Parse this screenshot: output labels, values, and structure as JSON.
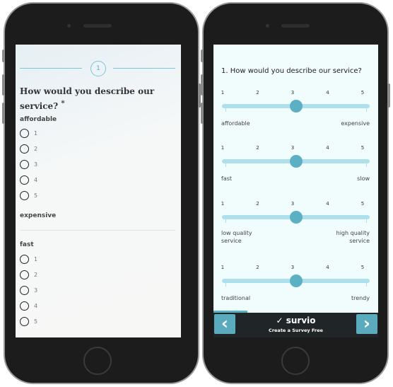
{
  "left": {
    "step": "1",
    "question": "How would you describe our service?",
    "required_mark": "*",
    "groups": [
      {
        "label": "affordable",
        "options": [
          "1",
          "2",
          "3",
          "4",
          "5"
        ],
        "end_label": "expensive"
      },
      {
        "label": "fast",
        "options": [
          "1",
          "2",
          "3",
          "4",
          "5"
        ]
      }
    ]
  },
  "right": {
    "question": "1. How would you describe our service?",
    "scale": [
      "1",
      "2",
      "3",
      "4",
      "5"
    ],
    "sliders": [
      {
        "min_label": "affordable",
        "max_label": "expensive",
        "value": 3
      },
      {
        "min_label": "fast",
        "max_label": "slow",
        "value": 3
      },
      {
        "min_label": "low quality\nservice",
        "max_label": "high quality\nservice",
        "value": 3
      },
      {
        "min_label": "traditional",
        "max_label": "trendy",
        "value": 3
      }
    ],
    "footer": {
      "brand": "survio",
      "tagline": "Create a Survey Free",
      "prev": "‹",
      "next": "›"
    }
  },
  "colors": {
    "accent": "#5cb0c4",
    "track": "#aee0ec",
    "footer": "#202527"
  }
}
